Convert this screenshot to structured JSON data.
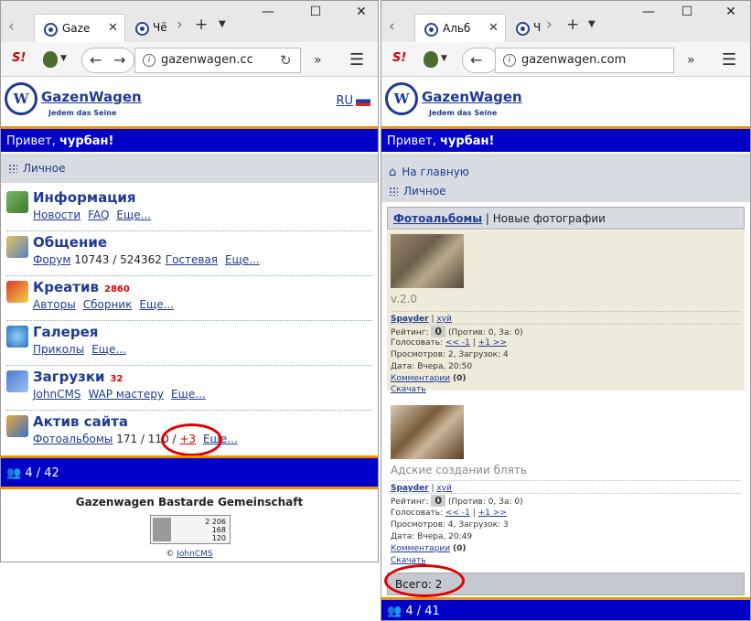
{
  "left": {
    "tabs": [
      {
        "label": "Gaze"
      },
      {
        "label": "Чё"
      }
    ],
    "url": "gazenwagen.cc",
    "brand": "GazenWagen",
    "slogan": "Jedem das Seine",
    "lang": "RU",
    "greeting_prefix": "Привет, ",
    "greeting_user": "чурбан!",
    "personal": "Личное",
    "menu": [
      {
        "title": "Информация",
        "count": "",
        "links": [
          "Новости",
          "FAQ",
          "Еще..."
        ],
        "text": ""
      },
      {
        "title": "Общение",
        "count": "",
        "links": [
          "Форум"
        ],
        "text": " 10743 / 524362 ",
        "links2": [
          "Гостевая",
          "Еще..."
        ]
      },
      {
        "title": "Креатив",
        "count": "2860",
        "links": [
          "Авторы",
          "Сборник",
          "Еще..."
        ],
        "text": ""
      },
      {
        "title": "Галерея",
        "count": "",
        "links": [
          "Приколы",
          "Еще..."
        ],
        "text": ""
      },
      {
        "title": "Загрузки",
        "count": "32",
        "links": [
          "JohnCMS",
          "WAP мастеру",
          "Еще..."
        ],
        "text": ""
      },
      {
        "title": "Актив сайта",
        "count": "",
        "links": [
          "Фотоальбомы"
        ],
        "text": " 171 / 110 / ",
        "links2": [
          "+3",
          "Еще..."
        ]
      }
    ],
    "online": "4 / 42",
    "footer": "Gazenwagen Bastarde Gemeinschaft",
    "counter": [
      "2 206",
      "168",
      "120"
    ],
    "copyright": "© ",
    "copyright_link": "JohnCMS"
  },
  "right": {
    "tabs": [
      {
        "label": "Альб"
      },
      {
        "label": "Ч"
      }
    ],
    "url": "gazenwagen.com",
    "brand": "GazenWagen",
    "slogan": "Jedem das Seine",
    "greeting_prefix": "Привет, ",
    "greeting_user": "чурбан!",
    "home": "На главную",
    "personal": "Личное",
    "albums_link": "Фотоальбомы",
    "albums_rest": " | Новые фотографии",
    "photos": [
      {
        "title": "v.2.0",
        "author": "Spayder",
        "tag": "хуй",
        "rating_label": "Рейтинг: ",
        "rating": "0",
        "rating_rest": " (Против: 0, За: 0)",
        "vote_label": "Голосовать: ",
        "vote_minus": "<< -1",
        "vote_plus": "+1 >>",
        "views": "Просмотров: 2, Загрузок: 4",
        "date": "Дата: Вчера, 20:50",
        "comments": "Комментарии",
        "comments_count": "(0)",
        "download": "Скачать"
      },
      {
        "title": "Адские создании блять",
        "author": "Spayder",
        "tag": "хуй",
        "rating_label": "Рейтинг: ",
        "rating": "0",
        "rating_rest": " (Против: 0, За: 0)",
        "vote_label": "Голосовать: ",
        "vote_minus": "<< -1",
        "vote_plus": "+1 >>",
        "views": "Просмотров: 4, Загрузок: 3",
        "date": "Дата: Вчера, 20:49",
        "comments": "Комментарии",
        "comments_count": "(0)",
        "download": "Скачать"
      }
    ],
    "total": "Всего: 2",
    "online": "4 / 41"
  }
}
